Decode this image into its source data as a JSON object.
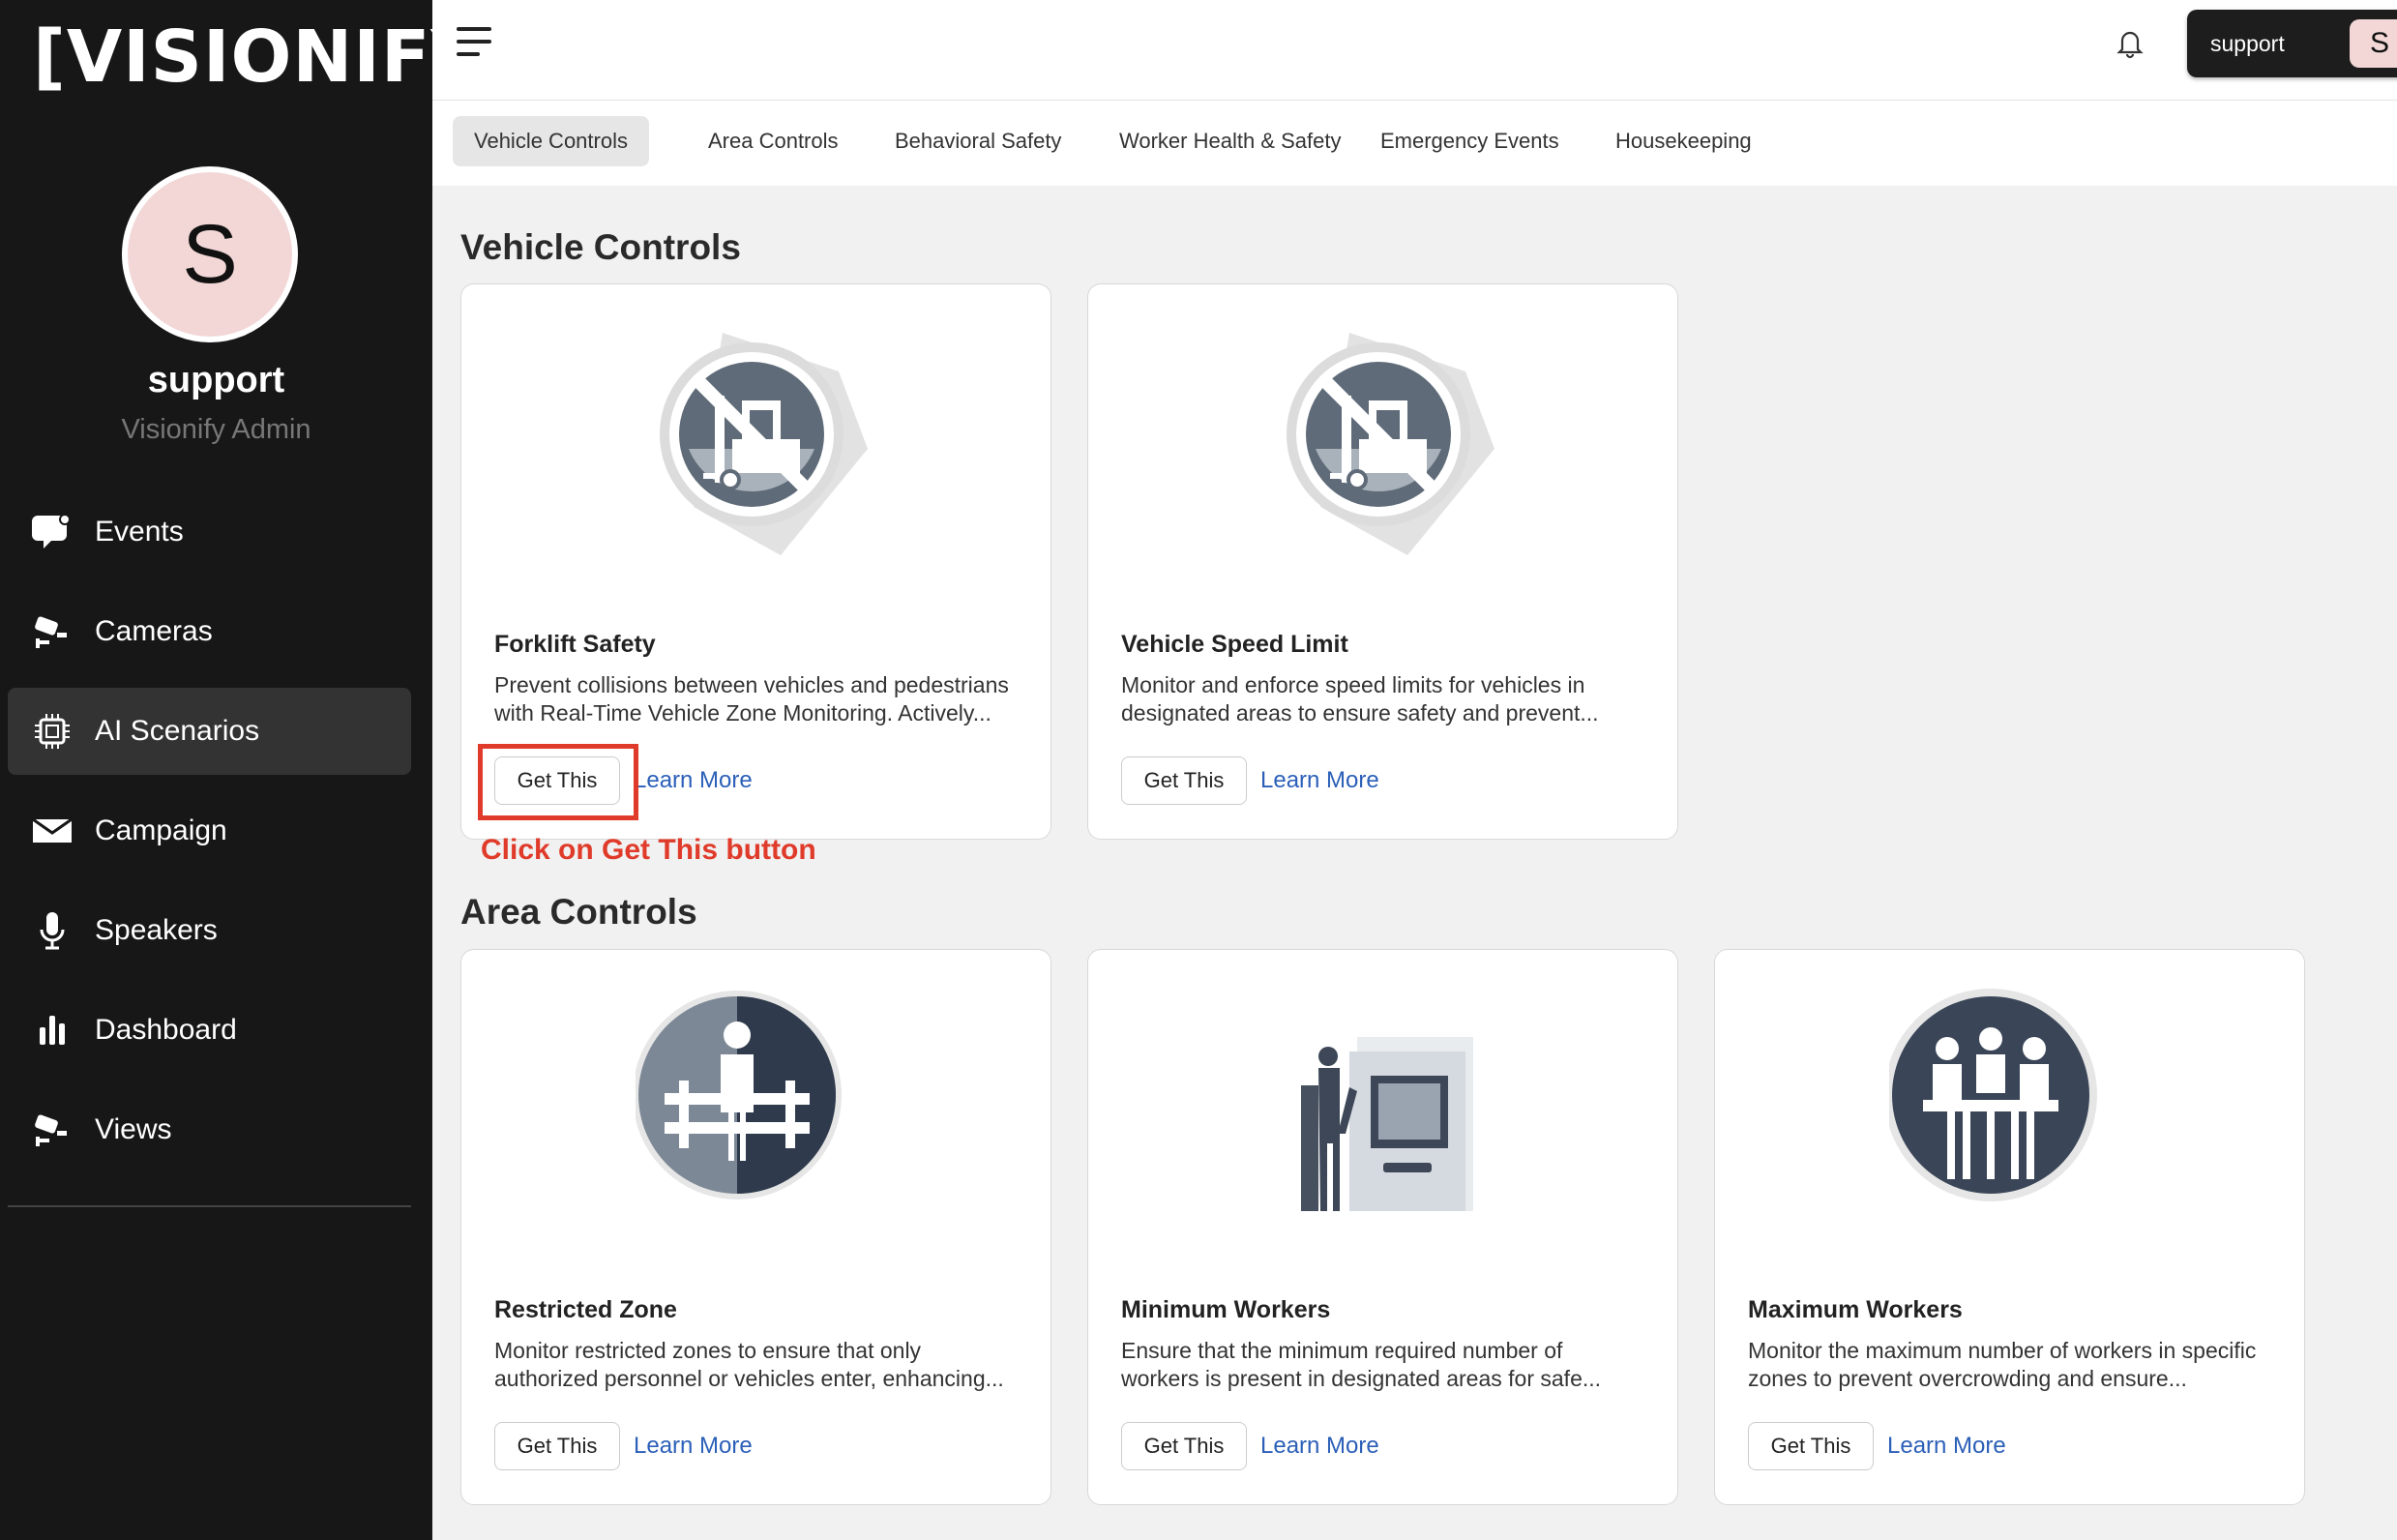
{
  "brand": {
    "logo_text": "[VISIONIFY]",
    "registered": "®"
  },
  "user": {
    "avatar_letter": "S",
    "name": "support",
    "role": "Visionify Admin"
  },
  "nav": {
    "items": [
      {
        "label": "Events",
        "icon": "events-icon"
      },
      {
        "label": "Cameras",
        "icon": "camera-icon"
      },
      {
        "label": "AI Scenarios",
        "icon": "chip-icon",
        "active": true
      },
      {
        "label": "Campaign",
        "icon": "mail-icon"
      },
      {
        "label": "Speakers",
        "icon": "microphone-icon"
      },
      {
        "label": "Dashboard",
        "icon": "bar-chart-icon"
      },
      {
        "label": "Views",
        "icon": "camera-icon"
      }
    ]
  },
  "topbar": {
    "user_label": "support",
    "avatar_letter": "S",
    "bell_icon": "bell-icon",
    "menu_icon": "hamburger-icon"
  },
  "tabs": [
    {
      "label": "Vehicle Controls",
      "active": true
    },
    {
      "label": "Area Controls"
    },
    {
      "label": "Behavioral Safety"
    },
    {
      "label": "Worker Health & Safety"
    },
    {
      "label": "Emergency Events"
    },
    {
      "label": "Housekeeping"
    }
  ],
  "sections": [
    {
      "title": "Vehicle Controls",
      "cards": [
        {
          "title": "Forklift Safety",
          "desc_line1": "Prevent collisions between vehicles and pedestrians",
          "desc_line2": "with Real-Time Vehicle Zone Monitoring. Actively...",
          "get_label": "Get This",
          "learn_label": "Learn More",
          "image": "no-forklift-icon"
        },
        {
          "title": "Vehicle Speed Limit",
          "desc_line1": "Monitor and enforce speed limits for vehicles in",
          "desc_line2": "designated areas to ensure safety and prevent...",
          "get_label": "Get This",
          "learn_label": "Learn More",
          "image": "no-forklift-icon"
        }
      ]
    },
    {
      "title": "Area Controls",
      "cards": [
        {
          "title": "Restricted Zone",
          "desc_line1": "Monitor restricted zones to ensure that only",
          "desc_line2": "authorized personnel or vehicles enter, enhancing...",
          "get_label": "Get This",
          "learn_label": "Learn More",
          "image": "worker-fence-icon"
        },
        {
          "title": "Minimum Workers",
          "desc_line1": "Ensure that the minimum required number of",
          "desc_line2": "workers is present in designated areas for safe...",
          "get_label": "Get This",
          "learn_label": "Learn More",
          "image": "worker-machine-icon"
        },
        {
          "title": "Maximum Workers",
          "desc_line1": "Monitor the maximum number of workers in specific",
          "desc_line2": "zones to prevent overcrowding and ensure...",
          "get_label": "Get This",
          "learn_label": "Learn More",
          "image": "workers-group-icon"
        }
      ]
    }
  ],
  "annotation": {
    "text": "Click on Get This button",
    "color": "#e03b2a"
  }
}
